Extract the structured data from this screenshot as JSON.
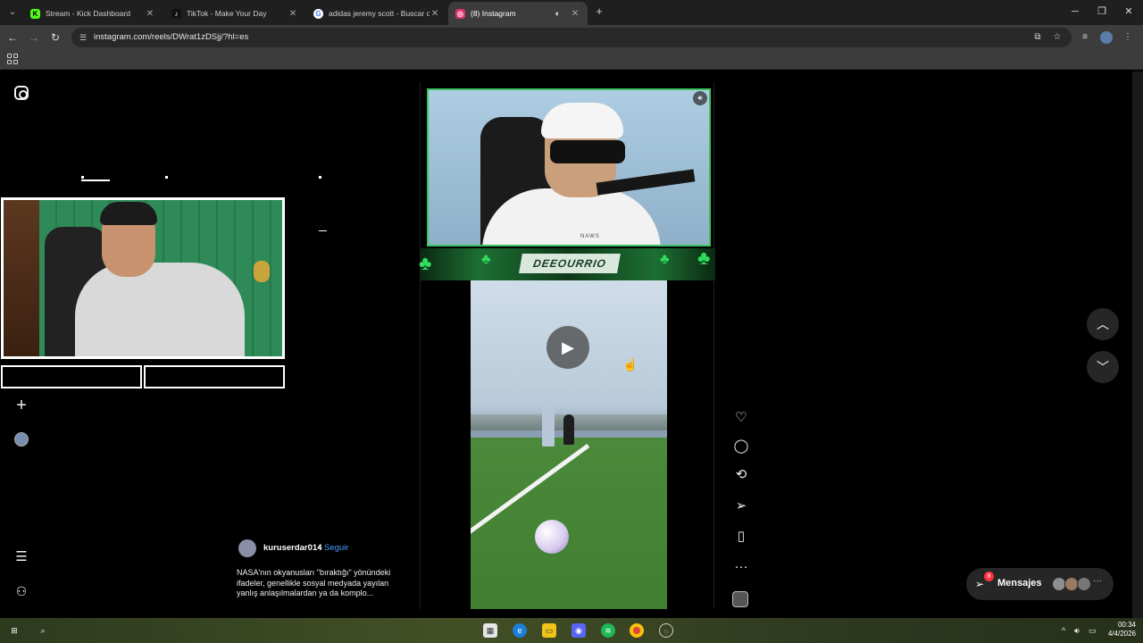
{
  "browser": {
    "tabs": [
      {
        "title": "Stream - Kick Dashboard",
        "favicon_color": "#53fc18",
        "favicon_glyph": "K"
      },
      {
        "title": "TikTok - Make Your Day",
        "favicon_color": "#111111",
        "favicon_glyph": "♪"
      },
      {
        "title": "adidas jeremy scott - Buscar co",
        "favicon_color": "#ffffff",
        "favicon_glyph": "G"
      },
      {
        "title": "(8) Instagram",
        "favicon_color": "#e1306c",
        "favicon_glyph": "◎"
      }
    ],
    "active_tab": 3,
    "url": "instagram.com/reels/DWrat1zDSjj/?hl=es"
  },
  "reel": {
    "stream_banner": "DEEOURRIO",
    "streamer_shirt_text": "NAWS",
    "author": "kuruserdar014",
    "follow_label": "Seguir",
    "separator": "•",
    "caption": "NASA'nın okyanusları \"bıraktığı\" yönündeki ifadeler, genellikle sosyal medyada yayılan yanlış anlaşılmalardan ya da komplo..."
  },
  "messages": {
    "label": "Mensajes",
    "badge": "8"
  },
  "taskbar": {
    "time": "00:34",
    "date": "4/4/2026"
  },
  "icons": {
    "instagram": "instagram-icon",
    "create": "plus-icon",
    "like": "heart-icon",
    "comment": "comment-icon",
    "repost": "repost-icon",
    "share": "send-icon",
    "save": "bookmark-icon",
    "more": "ellipsis-icon"
  },
  "colors": {
    "accent_link": "#4a9df8",
    "stream_green": "#3bc45f",
    "notification": "#ff3040"
  }
}
